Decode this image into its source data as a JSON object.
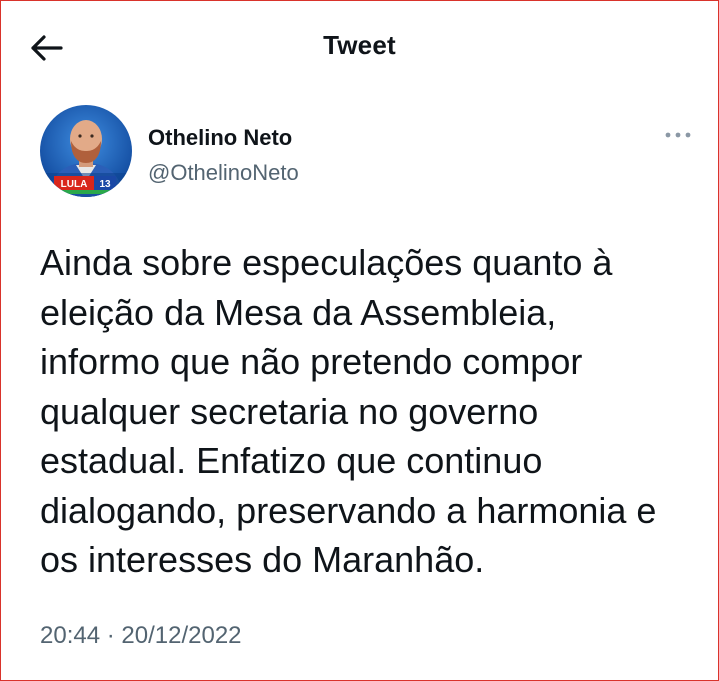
{
  "header": {
    "title": "Tweet",
    "back_icon": "arrow-left-icon"
  },
  "author": {
    "display_name": "Othelino Neto",
    "handle": "@OthelinoNeto",
    "avatar_badge": "LULA",
    "avatar_number": "13"
  },
  "more_icon": "more-horizontal-icon",
  "tweet": {
    "text": "Ainda sobre especulações quanto à\neleição da Mesa da Assembleia,\ninformo que não pretendo compor\nqualquer secretaria no governo\nestadual. Enfatizo que continuo\ndialogando, preservando a harmonia e\nos interesses do Maranhão."
  },
  "meta": {
    "time": "20:44",
    "separator": "·",
    "date": "20/12/2022"
  },
  "colors": {
    "text": "#0f1419",
    "secondary": "#536471",
    "frame": "#d9332b",
    "avatar_bg": "#1d5fc4"
  }
}
